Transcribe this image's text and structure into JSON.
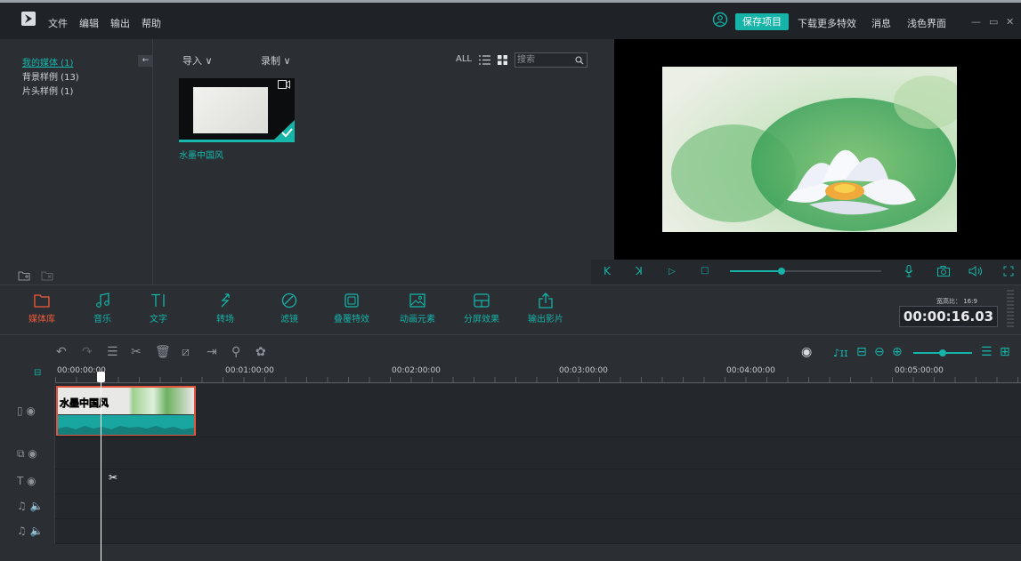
{
  "titlebar": {
    "menus": [
      "文件",
      "编辑",
      "输出",
      "帮助"
    ],
    "save_project": "保存项目",
    "right_menus": [
      "下载更多特效",
      "消息",
      "浅色界面"
    ],
    "window_controls": [
      "—",
      "▭",
      "✕"
    ]
  },
  "library": {
    "items": [
      "我的媒体 (1)",
      "背景样例 (13)",
      "片头样例 (1)"
    ],
    "back_icon": "←"
  },
  "media_toolbar": {
    "import": "导入 ∨",
    "record": "录制 ∨",
    "filter_all": "ALL",
    "search_placeholder": "搜索"
  },
  "media_items": [
    {
      "label": "水墨中国风"
    }
  ],
  "tabs": [
    {
      "label": "媒体库",
      "icon": "folder-icon",
      "active": true
    },
    {
      "label": "音乐",
      "icon": "music-icon"
    },
    {
      "label": "文字",
      "icon": "text-icon"
    },
    {
      "label": "转场",
      "icon": "transition-icon"
    },
    {
      "label": "滤镜",
      "icon": "filter-icon"
    },
    {
      "label": "叠覆特效",
      "icon": "overlay-icon"
    },
    {
      "label": "动画元素",
      "icon": "image-icon"
    },
    {
      "label": "分屏效果",
      "icon": "split-icon"
    },
    {
      "label": "输出影片",
      "icon": "export-icon"
    }
  ],
  "preview": {
    "aspect_label": "宽高比： 16:9",
    "timecode": "00:00:16.03",
    "progress": 0.34
  },
  "ruler": {
    "ticks": [
      "00:00:00:00",
      "00:01:00:00",
      "00:02:00:00",
      "00:03:00:00",
      "00:04:00:00",
      "00:05:00:00"
    ]
  },
  "timeline": {
    "clip_label": "水墨中国风"
  },
  "colors": {
    "accent": "#15b3a8",
    "active_tab": "#f05a3a",
    "clip_border": "#e2553c"
  }
}
